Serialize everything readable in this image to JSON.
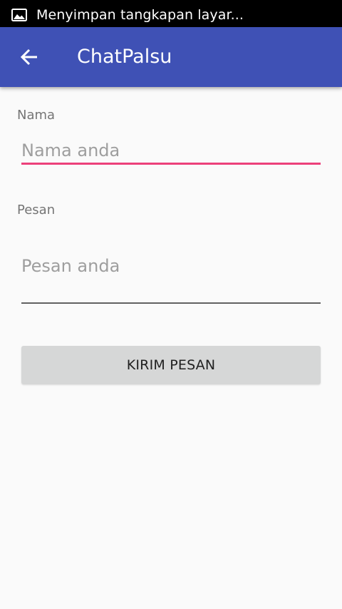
{
  "status_bar": {
    "notification_icon": "image-icon",
    "notification_text": "Menyimpan tangkapan layar..."
  },
  "app_bar": {
    "back_icon": "arrow-back-icon",
    "title": "ChatPalsu",
    "color": "#3f51b5"
  },
  "form": {
    "name_label": "Nama",
    "name_placeholder": "Nama anda",
    "name_value": "",
    "message_label": "Pesan",
    "message_placeholder": "Pesan anda",
    "message_value": "",
    "submit_label": "KIRIM PESAN",
    "focus_accent_color": "#ec407a"
  }
}
